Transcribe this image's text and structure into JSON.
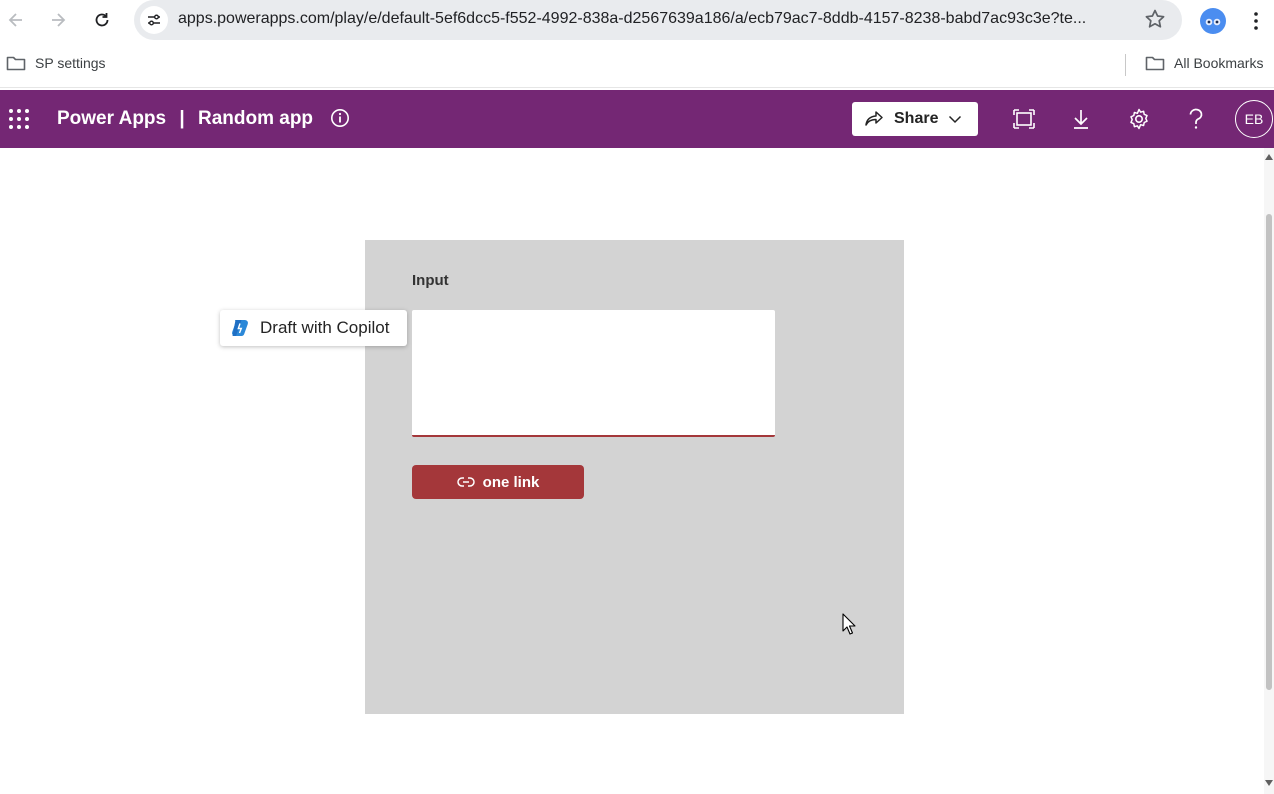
{
  "browser": {
    "url": "apps.powerapps.com/play/e/default-5ef6dcc5-f552-4992-838a-d2567639a186/a/ecb79ac7-8ddb-4157-8238-babd7ac93c3e?te...",
    "back_icon": "arrow-left-icon",
    "forward_icon": "arrow-right-icon",
    "reload_icon": "reload-icon"
  },
  "bookmarks": {
    "left_item": "SP settings",
    "right_item": "All Bookmarks"
  },
  "header": {
    "product": "Power Apps",
    "separator": "|",
    "app_name": "Random app",
    "share_label": "Share",
    "avatar_initials": "EB",
    "color": "#742774"
  },
  "app": {
    "input_label": "Input",
    "input_value": "",
    "button_label": "one link",
    "button_color": "#a4373a",
    "copilot_label": "Draft with Copilot"
  }
}
